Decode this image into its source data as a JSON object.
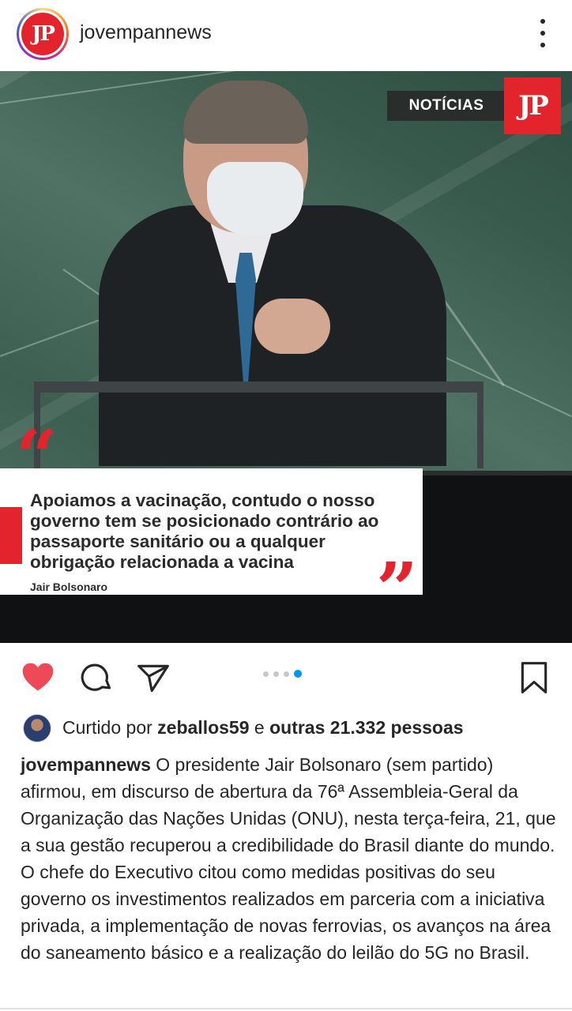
{
  "header": {
    "username": "jovempannews",
    "avatar_text": "JP"
  },
  "post": {
    "tag": "NOTÍCIAS",
    "logo_text": "JP",
    "quote": "Apoiamos a vacinação, contudo o nosso governo tem se posicionado contrário ao passaporte sanitário ou a qualquer obrigação relacionada a vacina",
    "quote_author": "Jair Bolsonaro",
    "carousel": {
      "total": 4,
      "active": 4
    }
  },
  "likes": {
    "prefix": "Curtido por",
    "liker": "zeballos59",
    "conjunction": "e",
    "others": "outras 21.332 pessoas"
  },
  "caption": {
    "username": "jovempannews",
    "text": "O presidente Jair Bolsonaro (sem partido) afirmou, em discurso de abertura da 76ª Assembleia-Geral da Organização das Nações Unidas (ONU), nesta terça-feira, 21, que a sua gestão recuperou a credibilidade do Brasil diante do mundo. O chefe do Executivo citou como medidas positivas do seu governo os investimentos realizados em parceria com a iniciativa privada, a implementação de novas ferrovias, os avanços na área do saneamento básico e a realização do leilão do 5G no Brasil."
  },
  "icons": {
    "like": "heart-icon",
    "comment": "comment-icon",
    "share": "send-icon",
    "save": "bookmark-icon",
    "more": "more-vertical-icon"
  },
  "colors": {
    "brand_red": "#e4242d",
    "like_red": "#ed4956",
    "carousel_active": "#0095f6"
  }
}
